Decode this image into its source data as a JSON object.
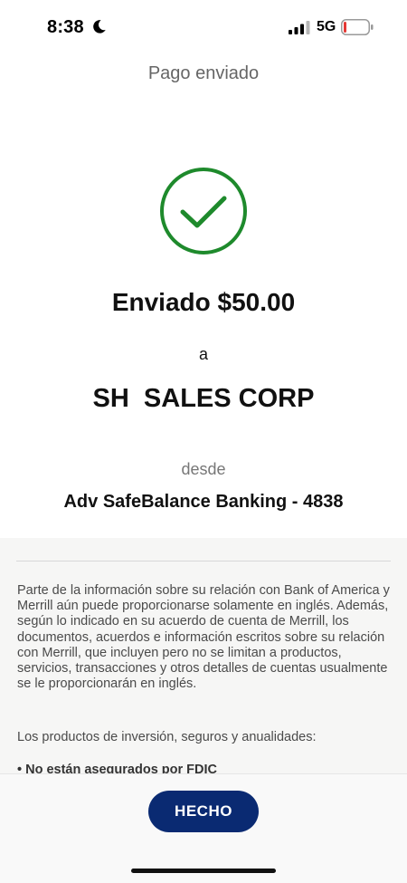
{
  "status_bar": {
    "time": "8:38",
    "network": "5G",
    "icons": [
      "moon-icon",
      "cellular-signal-icon",
      "battery-icon"
    ]
  },
  "header": {
    "title": "Pago enviado"
  },
  "confirmation": {
    "icon": "checkmark-circle-icon",
    "accent_color": "#1e8a2c",
    "amount_text": "Enviado $50.00",
    "to_label": "a",
    "recipient": "SH  SALES CORP",
    "from_label": "desde",
    "account": "Adv SafeBalance Banking - 4838"
  },
  "disclosure": {
    "text": "Parte de la información sobre su relación con Bank of America y Merrill aún puede proporcionarse solamente en inglés. Además, según lo indicado en su acuerdo de cuenta de Merrill, los documentos, acuerdos e información escritos sobre su relación con Merrill, que incluyen pero no se limitan a productos, servicios, transacciones y otros detalles de cuentas usualmente se le proporcionarán en inglés.",
    "subheading": "Los productos de inversión, seguros y anualidades:",
    "bullet": "• No están asegurados por FDIC"
  },
  "footer": {
    "done_label": "HECHO",
    "button_color": "#0a2a72"
  }
}
